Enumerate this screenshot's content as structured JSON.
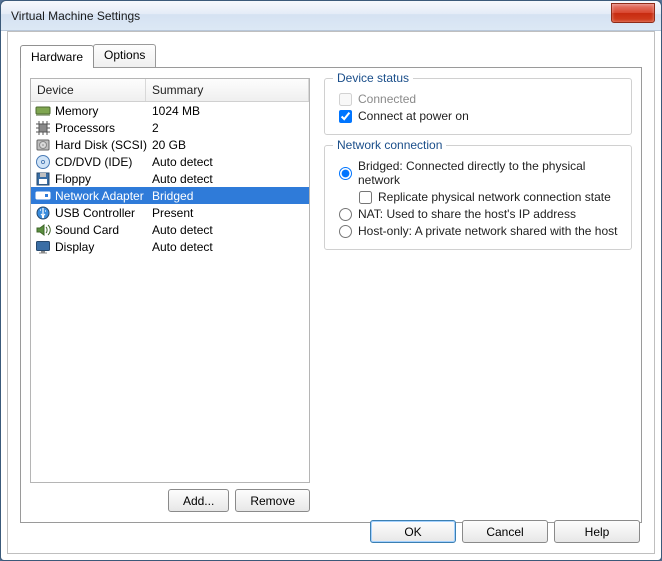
{
  "window": {
    "title": "Virtual Machine Settings"
  },
  "tabs": {
    "hardware": "Hardware",
    "options": "Options"
  },
  "list": {
    "headers": {
      "device": "Device",
      "summary": "Summary"
    },
    "rows": [
      {
        "device": "Memory",
        "summary": "1024 MB",
        "icon": "memory"
      },
      {
        "device": "Processors",
        "summary": "2",
        "icon": "cpu"
      },
      {
        "device": "Hard Disk (SCSI)",
        "summary": "20 GB",
        "icon": "hdd"
      },
      {
        "device": "CD/DVD (IDE)",
        "summary": "Auto detect",
        "icon": "cd"
      },
      {
        "device": "Floppy",
        "summary": "Auto detect",
        "icon": "floppy"
      },
      {
        "device": "Network Adapter",
        "summary": "Bridged",
        "icon": "nic",
        "selected": true
      },
      {
        "device": "USB Controller",
        "summary": "Present",
        "icon": "usb"
      },
      {
        "device": "Sound Card",
        "summary": "Auto detect",
        "icon": "sound"
      },
      {
        "device": "Display",
        "summary": "Auto detect",
        "icon": "display"
      }
    ]
  },
  "buttons": {
    "add": "Add...",
    "remove": "Remove",
    "ok": "OK",
    "cancel": "Cancel",
    "help": "Help"
  },
  "device_status": {
    "title": "Device status",
    "connected": "Connected",
    "connect_power_on": "Connect at power on",
    "connected_checked": false,
    "connected_enabled": false,
    "power_on_checked": true
  },
  "network": {
    "title": "Network connection",
    "bridged": "Bridged: Connected directly to the physical network",
    "replicate": "Replicate physical network connection state",
    "nat": "NAT: Used to share the host's IP address",
    "hostonly": "Host-only: A private network shared with the host",
    "selected": "bridged",
    "replicate_checked": false
  }
}
